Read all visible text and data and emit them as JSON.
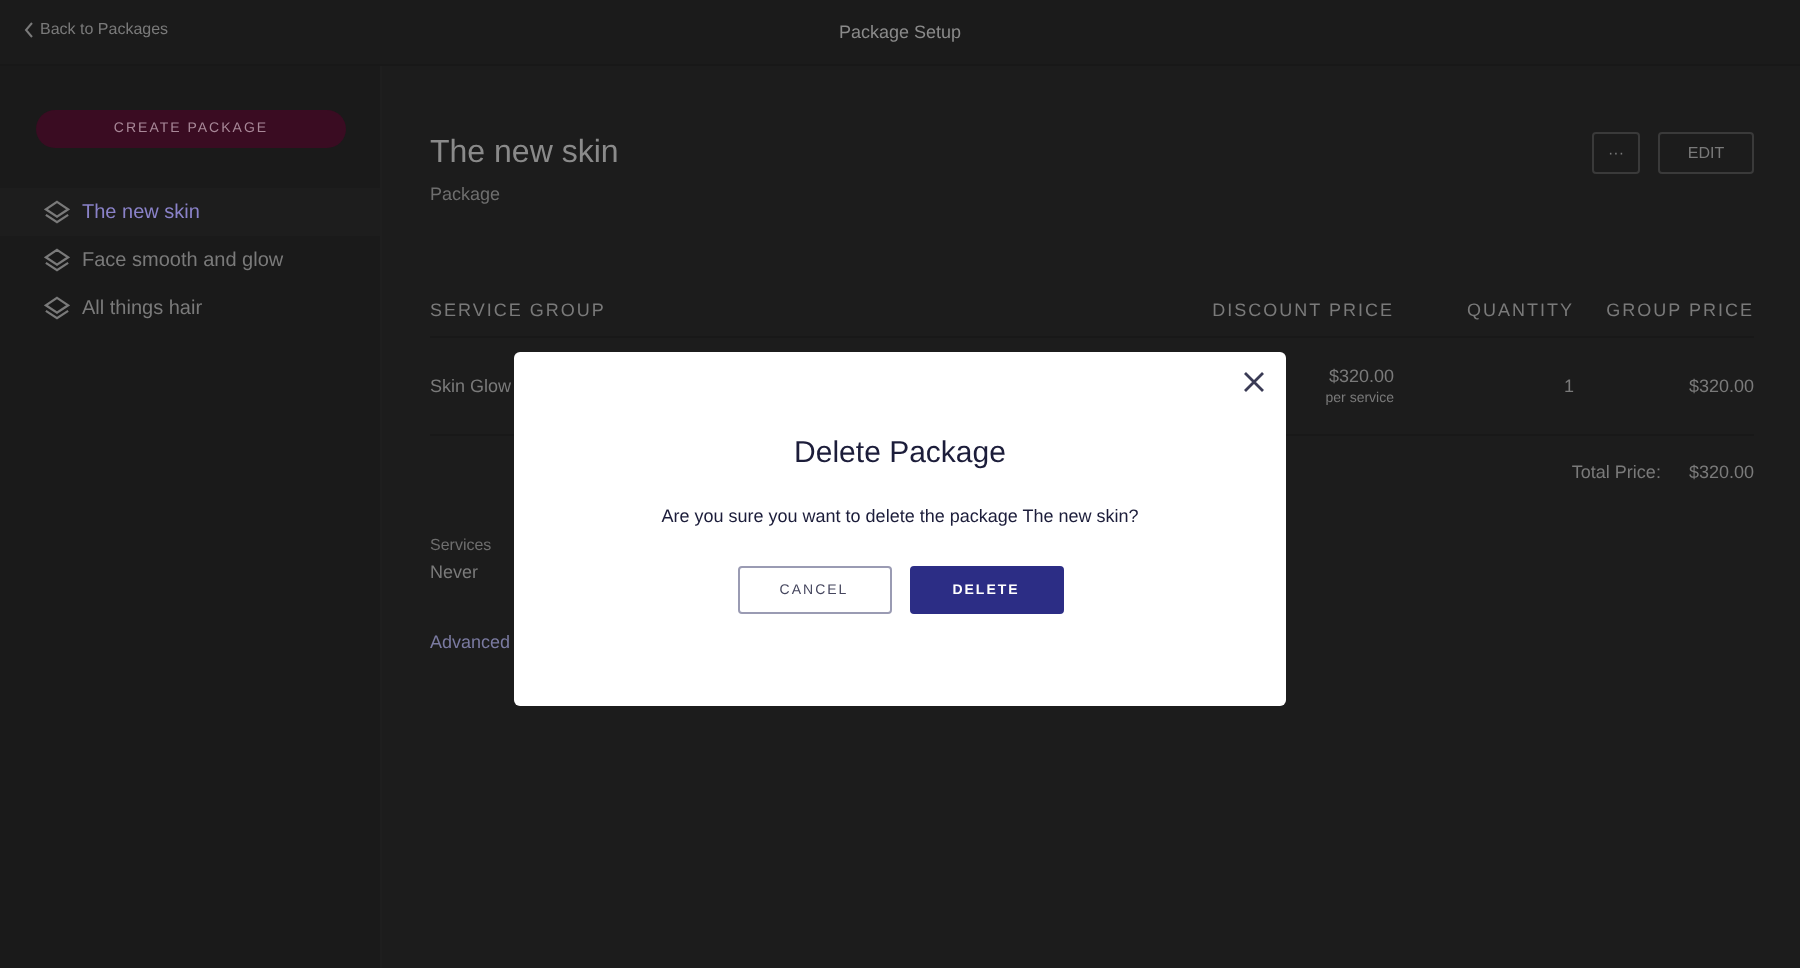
{
  "header": {
    "back_link": "Back to Packages",
    "title": "Package Setup"
  },
  "sidebar": {
    "create_button": "CREATE PACKAGE",
    "items": [
      {
        "label": "The new skin",
        "selected": true
      },
      {
        "label": "Face smooth and glow",
        "selected": false
      },
      {
        "label": "All things hair",
        "selected": false
      }
    ]
  },
  "package": {
    "name": "The new skin",
    "type": "Package",
    "more_button": "···",
    "edit_button": "EDIT"
  },
  "table": {
    "columns": [
      "SERVICE GROUP",
      "DISCOUNT PRICE",
      "QUANTITY",
      "GROUP PRICE"
    ],
    "rows": [
      {
        "service_group": "Skin Glow",
        "discount_price": "$320.00",
        "price_note": "per service",
        "quantity": "1",
        "group_price": "$320.00"
      }
    ],
    "total_label": "Total Price:",
    "total_value": "$320.00"
  },
  "details": {
    "services_label": "Services",
    "services_value": "Never",
    "advanced_link": "Advanced"
  },
  "dialog": {
    "title": "Delete Package",
    "message": "Are you sure you want to delete the package The new skin?",
    "cancel_button": "CANCEL",
    "delete_button": "DELETE"
  }
}
